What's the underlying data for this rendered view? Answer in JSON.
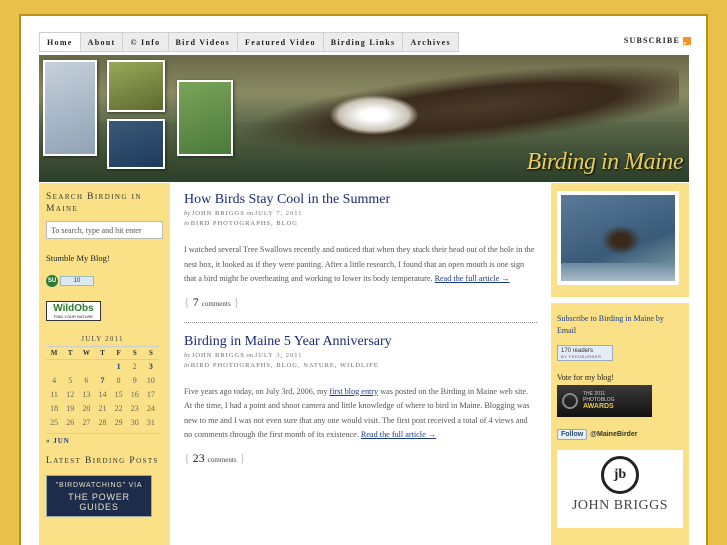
{
  "nav": {
    "items": [
      "Home",
      "About",
      "© Info",
      "Bird Videos",
      "Featured Video",
      "Birding Links",
      "Archives"
    ],
    "subscribe": "Subscribe"
  },
  "header": {
    "brand": "Birding in Maine"
  },
  "left": {
    "search_heading": "Search Birding in Maine",
    "search_placeholder": "To search, type and hit enter",
    "stumble_title": "Stumble My Blog!",
    "stumble_icon": "SU",
    "stumble_count": "10",
    "wildobs_name": "WildObs",
    "wildobs_tag": "FIND YOUR NATURE",
    "calendar": {
      "caption": "July 2011",
      "days": [
        "M",
        "T",
        "W",
        "T",
        "F",
        "S",
        "S"
      ],
      "rows": [
        [
          "",
          "",
          "",
          "",
          "1",
          "2",
          "3"
        ],
        [
          "4",
          "5",
          "6",
          "7",
          "8",
          "9",
          "10"
        ],
        [
          "11",
          "12",
          "13",
          "14",
          "15",
          "16",
          "17"
        ],
        [
          "18",
          "19",
          "20",
          "21",
          "22",
          "23",
          "24"
        ],
        [
          "25",
          "26",
          "27",
          "28",
          "29",
          "30",
          "31"
        ]
      ],
      "links": [
        "1",
        "3",
        "7"
      ],
      "prev": "« Jun"
    },
    "latest_heading": "Latest Birding Posts",
    "guide_line1": "\"BIRDWATCHING\" VIA",
    "guide_line2": "THE POWER GUIDES"
  },
  "posts": [
    {
      "title": "How Birds Stay Cool in the Summer",
      "by": "by",
      "author": "JOHN BRIGGS",
      "on": "on",
      "date": "JULY 7, 2011",
      "in": "in",
      "categories": "BIRD PHOTOGRAPHS, BLOG",
      "body": "I watched several Tree Swallows recently and noticed that when they stuck their head out of the hole in the nest box, it looked as if they were panting. After a little research, I found that an open mouth is one sign that a bird might be overheating and working to lower its body temperature.",
      "read_more": "Read the full article →",
      "comments_count": "7",
      "comments_word": "comments"
    },
    {
      "title": "Birding in Maine 5 Year Anniversary",
      "by": "by",
      "author": "JOHN BRIGGS",
      "on": "on",
      "date": "JULY 3, 2011",
      "in": "in",
      "categories": "BIRD PHOTOGRAPHS, BLOG, NATURE, WILDLIFE",
      "body_1": "Five years ago today, on July 3rd, 2006, my",
      "body_link": "first blog entry",
      "body_2": "was posted on the Birding in Maine web site. At the time, I had a point and shoot camera and little knowledge of where to bird in Maine. Blogging was new to me and I was not even sure that any one would visit. The first post received a total of 4 views and no comments through the first month of its existence.",
      "read_more": "Read the full article →",
      "comments_count": "23",
      "comments_word": "comments"
    }
  ],
  "right": {
    "subscribe_email": "Subscribe to Birding in Maine by Email",
    "feed_count": "170 readers",
    "feed_by": "BY FEEDBURNER",
    "vote": "Vote for my blog!",
    "award_line1": "THE 2011",
    "award_line2": "PHOTOBLOG",
    "award_line3": "AWARDS",
    "twitter_button": "Follow",
    "twitter_handle": "@MaineBirder",
    "jb_logo": "jb",
    "jb_name": "JOHN BRIGGS"
  }
}
